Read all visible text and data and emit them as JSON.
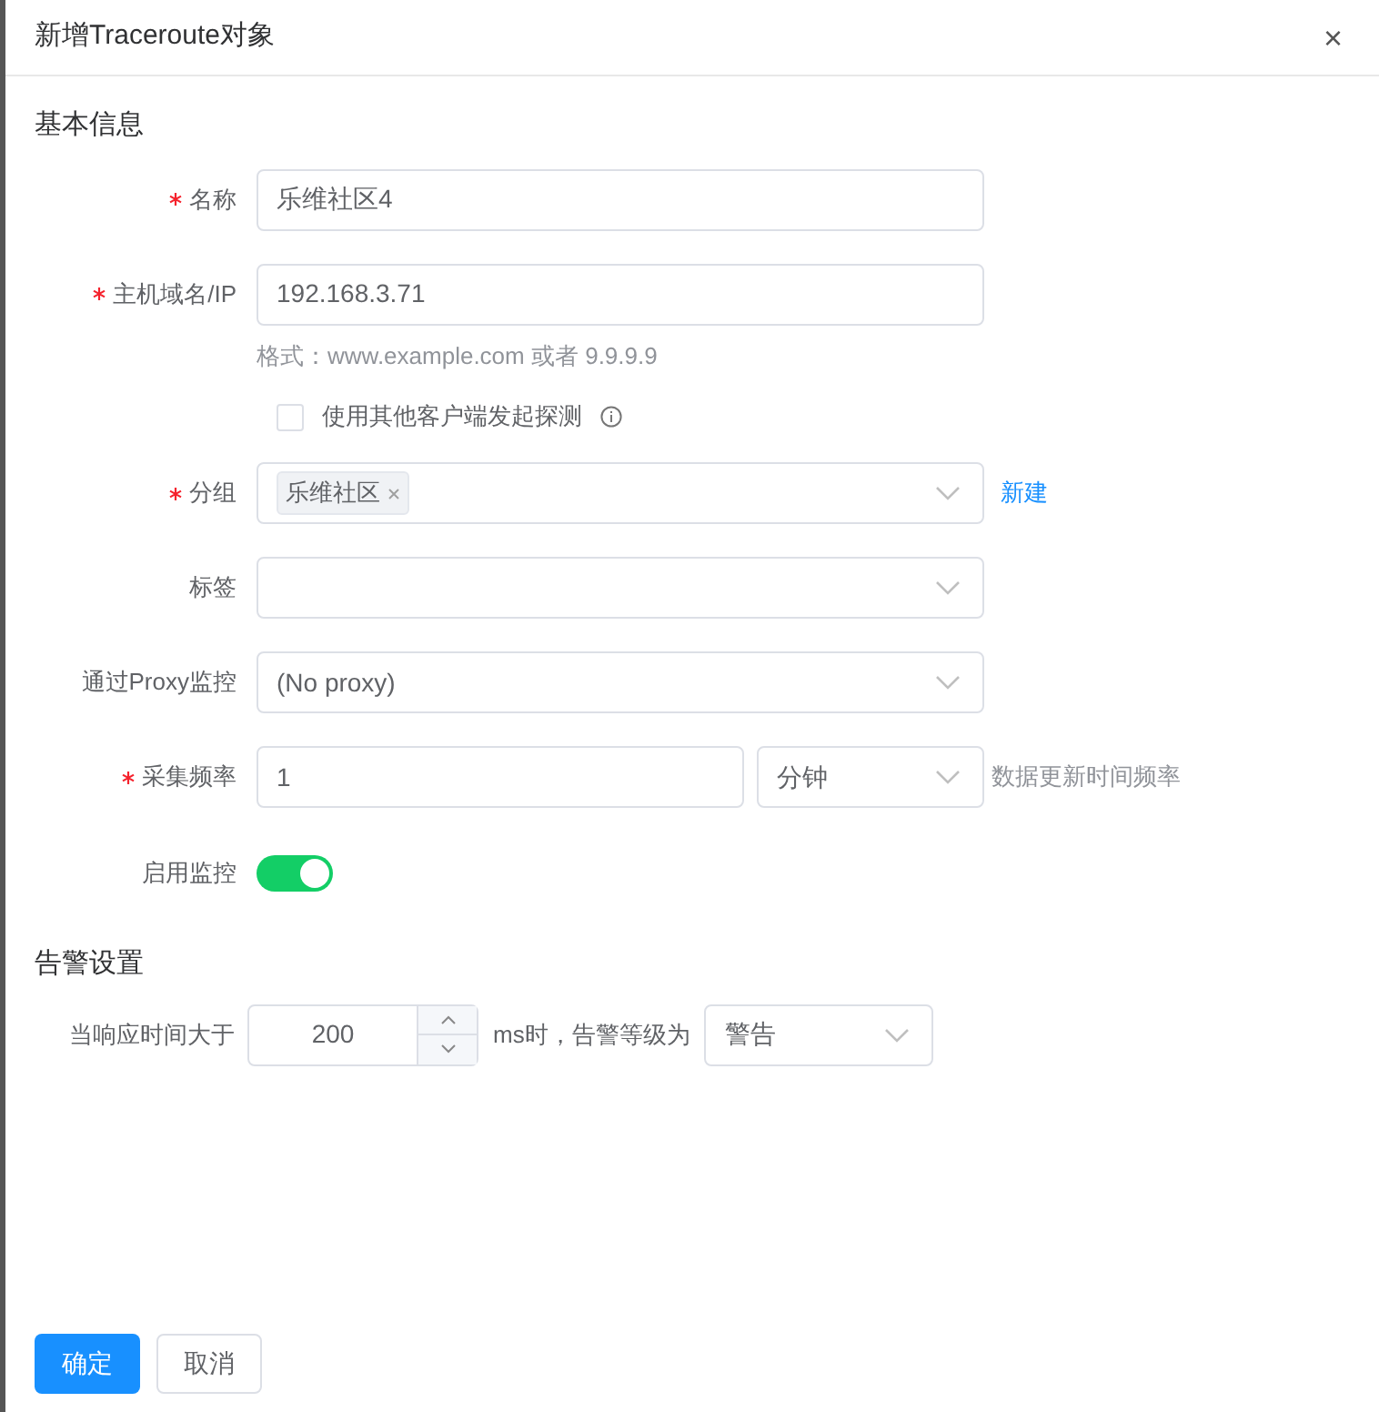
{
  "dialog": {
    "title": "新增Traceroute对象",
    "close": "×"
  },
  "sections": [
    {
      "title": "基本信息"
    }
  ],
  "fields": [
    {
      "kind": "text",
      "label": "名称",
      "required": true,
      "value": "乐维社区4"
    },
    {
      "kind": "text",
      "label": "主机域名/IP",
      "required": true,
      "value": "192.168.3.71",
      "help": "格式：www.example.com 或者 9.9.9.9"
    },
    {
      "kind": "checkbox",
      "label": "使用其他客户端发起探测",
      "checked": false
    },
    {
      "kind": "tags",
      "label": "分组",
      "required": true,
      "tags": [
        "乐维社区"
      ],
      "link": "新建"
    },
    {
      "kind": "select",
      "label": "标签",
      "required": false
    },
    {
      "kind": "select",
      "label": "通过Proxy监控",
      "required": false,
      "value": "(No proxy)"
    },
    {
      "kind": "interval",
      "label": "采集频率",
      "required": true,
      "value": "1",
      "unit": "分钟",
      "note": "数据更新时间频率"
    },
    {
      "kind": "switch",
      "label": "启用监控",
      "required": false,
      "on": true
    }
  ],
  "alert": {
    "title": "告警设置",
    "label": "当响应时间大于",
    "value": "200",
    "middle": "ms时，告警等级为",
    "level": "警告"
  },
  "buttons": [
    {
      "label": "确定",
      "primary": true
    },
    {
      "label": "取消",
      "primary": false
    }
  ]
}
